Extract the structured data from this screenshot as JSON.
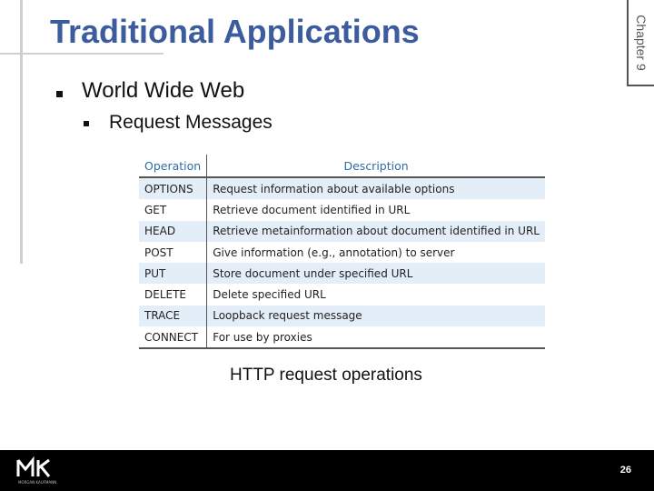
{
  "slide": {
    "title": "Traditional Applications",
    "chapter_label": "Chapter 9",
    "bullet_1": "World Wide Web",
    "bullet_2": "Request Messages",
    "caption": "HTTP request operations",
    "page_number": "26"
  },
  "table": {
    "headers": [
      "Operation",
      "Description"
    ],
    "rows": [
      {
        "op": "OPTIONS",
        "desc": "Request information about available options"
      },
      {
        "op": "GET",
        "desc": "Retrieve document identified in URL"
      },
      {
        "op": "HEAD",
        "desc": "Retrieve metainformation about document identified in URL"
      },
      {
        "op": "POST",
        "desc": "Give information (e.g., annotation) to server"
      },
      {
        "op": "PUT",
        "desc": "Store document under specified URL"
      },
      {
        "op": "DELETE",
        "desc": "Delete specified URL"
      },
      {
        "op": "TRACE",
        "desc": "Loopback request message"
      },
      {
        "op": "CONNECT",
        "desc": "For use by proxies"
      }
    ]
  },
  "footer": {
    "logo_letters": "MK",
    "logo_tagline": "MORGAN KAUFMANN"
  },
  "colors": {
    "title": "#3d5c9e",
    "header_text": "#2e6da4",
    "row_shade": "#e4eef8",
    "footer_bg": "#000000"
  }
}
